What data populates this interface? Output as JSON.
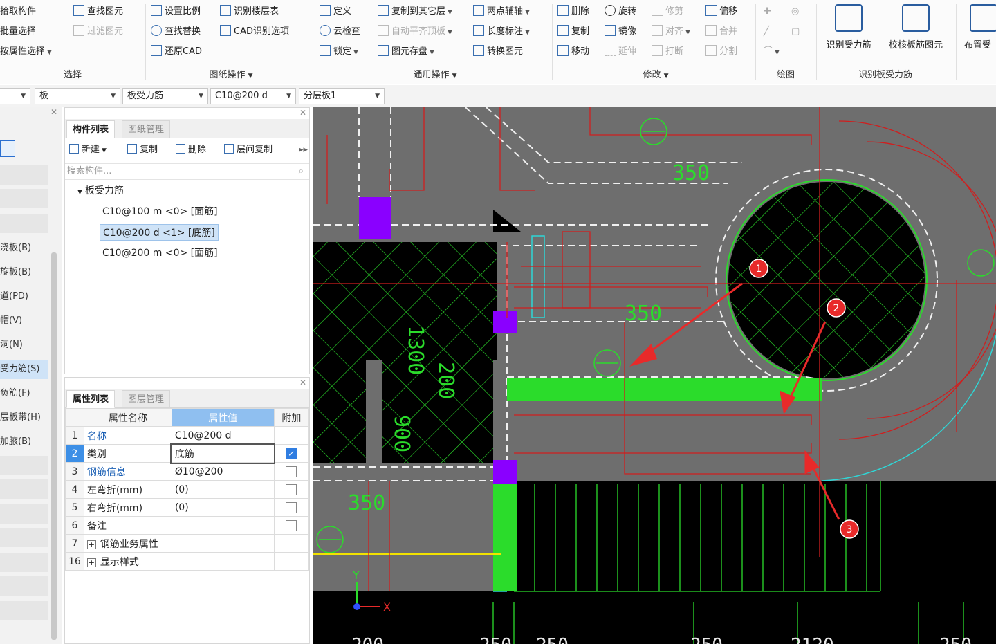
{
  "ribbon": {
    "select": {
      "pick": "拾取构件",
      "batch": "批量选择",
      "by_attr": "按属性选择",
      "find": "查找图元",
      "filter": "过滤图元",
      "label": "选择"
    },
    "drawing_ops": {
      "scale": "设置比例",
      "find_replace": "查找替换",
      "restore": "还原CAD",
      "floor_table": "识别楼层表",
      "cad_opts": "CAD识别选项",
      "label": "图纸操作"
    },
    "common_ops": {
      "define": "定义",
      "cloud_check": "云检查",
      "lock": "锁定",
      "copy_other": "复制到其它层",
      "auto_level": "自动平齐顶板",
      "save_elem": "图元存盘",
      "two_point": "两点辅轴",
      "length_dim": "长度标注",
      "convert": "转换图元",
      "label": "通用操作"
    },
    "modify": {
      "delete": "删除",
      "copy": "复制",
      "move": "移动",
      "rotate": "旋转",
      "mirror": "镜像",
      "extend": "延伸",
      "trim": "修剪",
      "align": "对齐",
      "break": "打断",
      "offset": "偏移",
      "merge": "合并",
      "split": "分割",
      "label": "修改"
    },
    "draw": {
      "label": "绘图"
    },
    "recognize": {
      "recognize_btn": "识别受力筋",
      "check_btn": "校核板筋图元",
      "label": "识别板受力筋"
    },
    "layout": {
      "layout_btn": "布置受"
    }
  },
  "filterbar": {
    "dd_kind": "板",
    "dd_type": "板受力筋",
    "dd_spec": "C10@200  d",
    "dd_layer": "分层板1"
  },
  "leftnav": {
    "items": [
      "浇板(B)",
      "旋板(B)",
      "道(PD)",
      "帽(V)",
      "洞(N)",
      "受力筋(S)",
      "负筋(F)",
      "层板带(H)",
      "加腋(B)"
    ],
    "active_index": 5
  },
  "component_panel": {
    "tab_list": "构件列表",
    "tab_drawing": "图纸管理",
    "btn_new": "新建",
    "btn_copy": "复制",
    "btn_delete": "删除",
    "btn_floor_copy": "层间复制",
    "search_placeholder": "搜索构件...",
    "tree_root": "板受力筋",
    "tree_items": [
      "C10@100  m <0> [面筋]",
      "C10@200  d <1> [底筋]",
      "C10@200  m <0> [面筋]"
    ],
    "selected_index": 1
  },
  "property_panel": {
    "tab_props": "属性列表",
    "tab_layers": "图层管理",
    "col_name": "属性名称",
    "col_value": "属性值",
    "col_extra": "附加",
    "rows": [
      {
        "num": "1",
        "name": "名称",
        "value": "C10@200  d",
        "link": true,
        "check": null
      },
      {
        "num": "2",
        "name": "类别",
        "value": "底筋",
        "link": false,
        "check": true
      },
      {
        "num": "3",
        "name": "钢筋信息",
        "value": "Ø10@200",
        "link": true,
        "check": false
      },
      {
        "num": "4",
        "name": "左弯折(mm)",
        "value": "(0)",
        "link": false,
        "check": false
      },
      {
        "num": "5",
        "name": "右弯折(mm)",
        "value": "(0)",
        "link": false,
        "check": false
      },
      {
        "num": "6",
        "name": "备注",
        "value": "",
        "link": false,
        "check": false
      },
      {
        "num": "7",
        "name": "钢筋业务属性",
        "value": "",
        "link": false,
        "check": null,
        "expand": true
      },
      {
        "num": "16",
        "name": "显示样式",
        "value": "",
        "link": false,
        "check": null,
        "expand": true
      }
    ]
  },
  "canvas": {
    "dims": [
      "1300",
      "200",
      "900",
      "350",
      "350",
      "350",
      "350"
    ],
    "bottom_dims": [
      "200",
      "250",
      "250",
      "250",
      "2120",
      "250"
    ],
    "markers": [
      "1",
      "2",
      "3"
    ],
    "axis_x": "X",
    "axis_y": "Y",
    "colors": {
      "bg": "#000000",
      "slab": "#6e6e6e",
      "rebar_red": "#d01e1e",
      "grid_green": "#2bdc2b",
      "highlight_purple": "#8a00ff",
      "cyan": "#2fd6d6",
      "yellow": "#f2e200"
    }
  }
}
